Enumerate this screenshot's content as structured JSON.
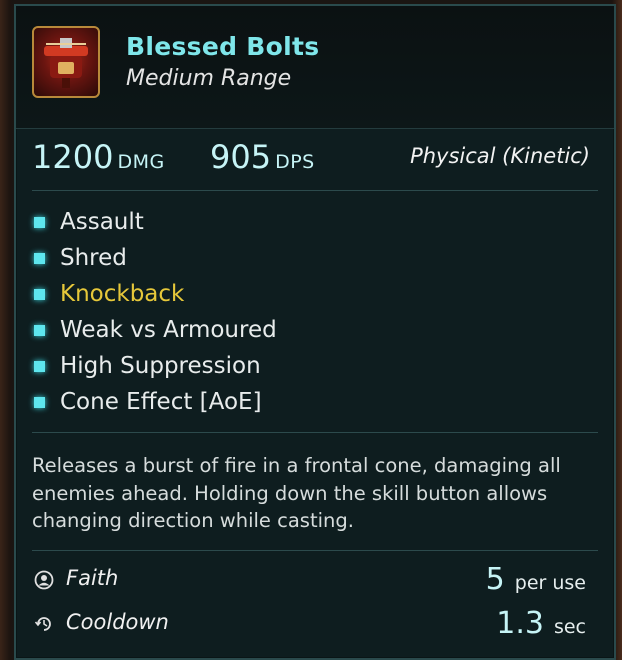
{
  "skill": {
    "name": "Blessed Bolts",
    "range": "Medium Range",
    "icon": "crossbow-bolts-icon"
  },
  "stats": {
    "damage_value": "1200",
    "damage_unit": "DMG",
    "dps_value": "905",
    "dps_unit": "DPS",
    "damage_type": "Physical (Kinetic)"
  },
  "traits": [
    {
      "label": "Assault",
      "highlight": false
    },
    {
      "label": "Shred",
      "highlight": false
    },
    {
      "label": "Knockback",
      "highlight": true
    },
    {
      "label": "Weak vs Armoured",
      "highlight": false
    },
    {
      "label": "High Suppression",
      "highlight": false
    },
    {
      "label": "Cone Effect [AoE]",
      "highlight": false
    }
  ],
  "description": "Releases a burst of fire in a frontal cone, damaging all enemies ahead. Holding down the skill button allows changing direction while casting.",
  "costs": {
    "faith": {
      "label": "Faith",
      "value": "5",
      "unit": "per use",
      "icon": "faith-icon"
    },
    "cooldown": {
      "label": "Cooldown",
      "value": "1.3",
      "unit": "sec",
      "icon": "cooldown-icon"
    }
  },
  "colors": {
    "title": "#7fe6ea",
    "highlight_trait": "#e6c83a",
    "bullet": "#5ee6ee",
    "panel_bg": "#0e1d1f"
  }
}
